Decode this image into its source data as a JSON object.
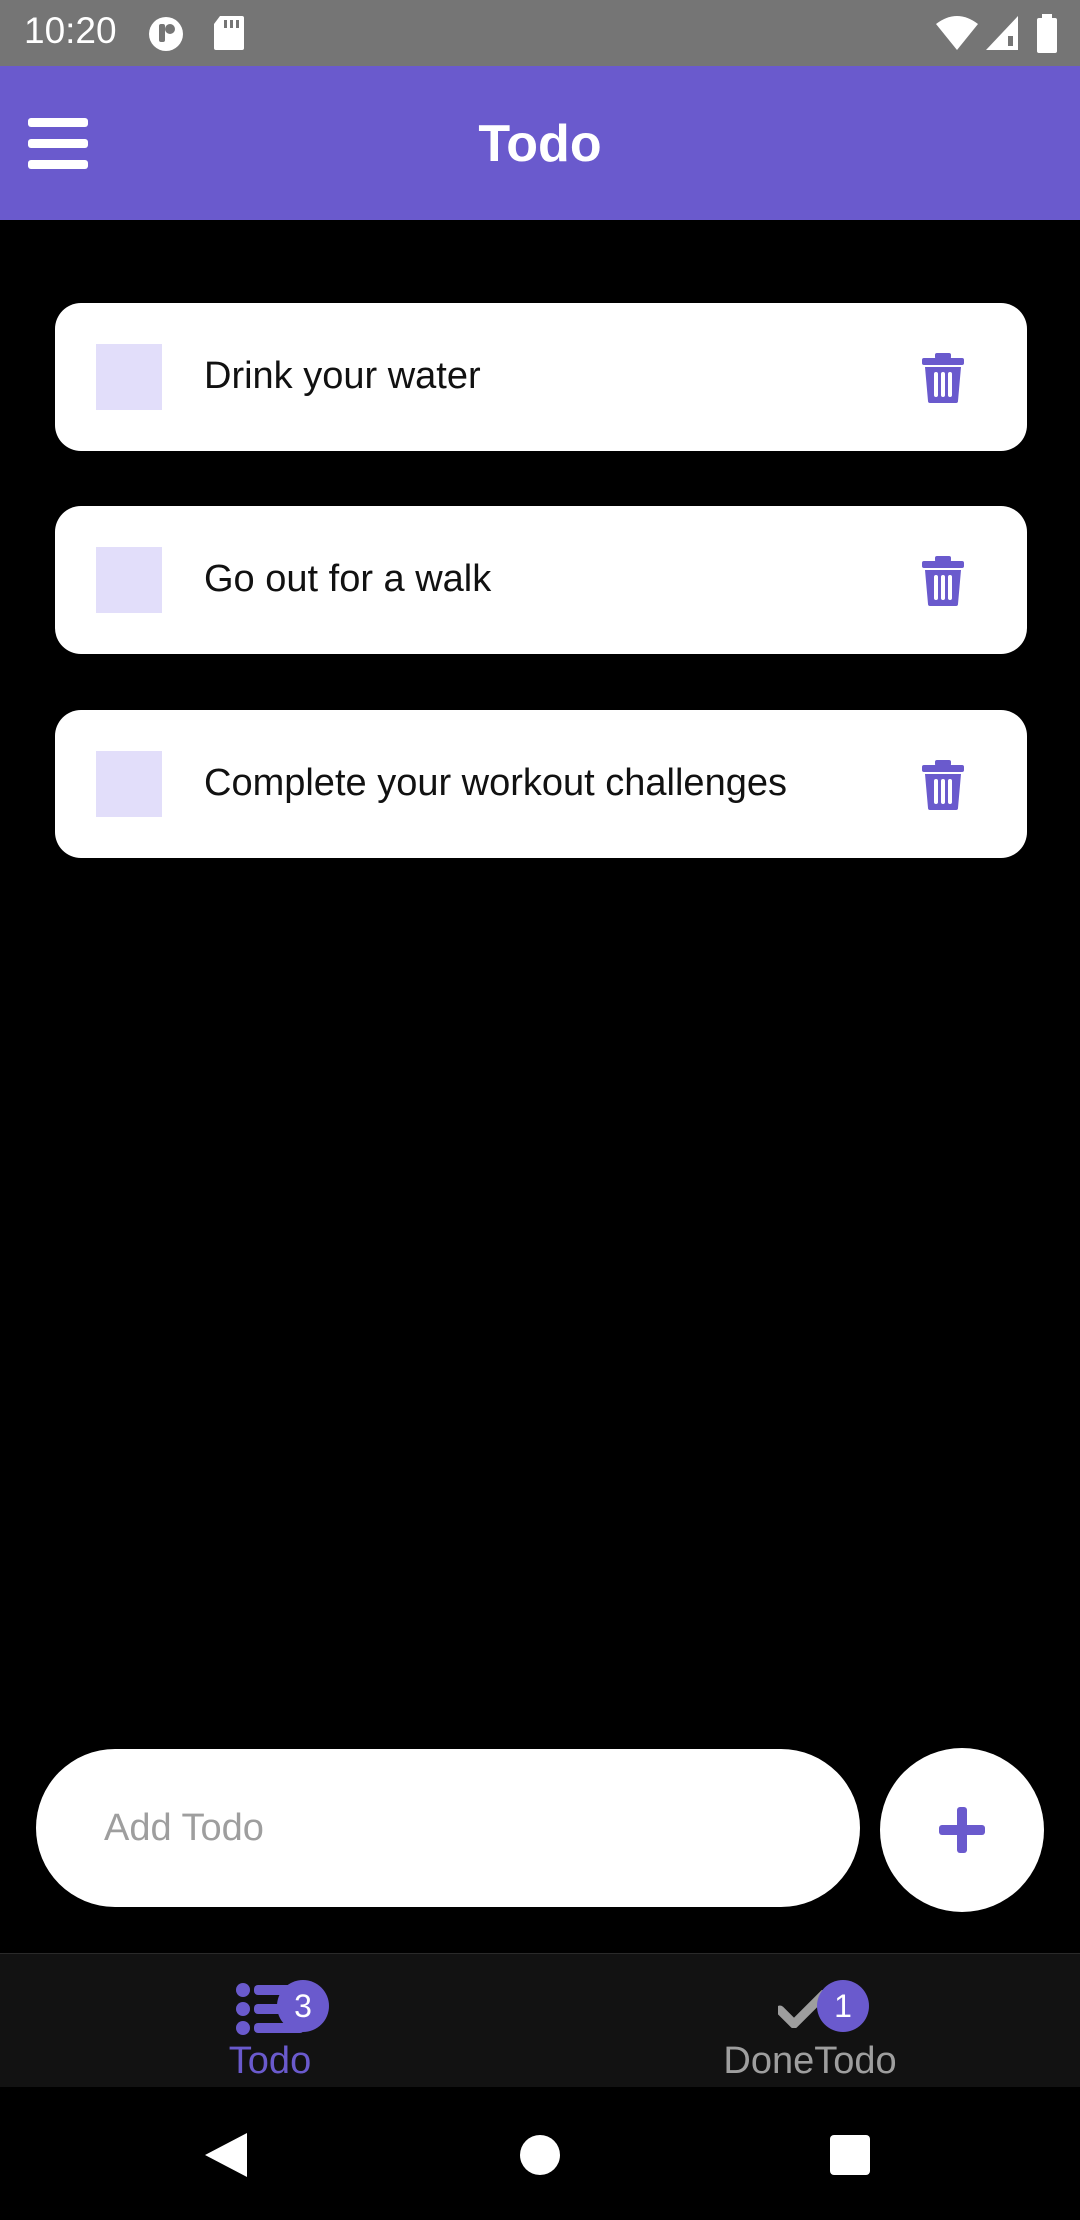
{
  "status_bar": {
    "time": "10:20",
    "icons": [
      "data-saver-icon",
      "sd-card-icon",
      "wifi-icon",
      "signal-icon",
      "battery-icon"
    ]
  },
  "app_bar": {
    "title": "Todo",
    "menu_icon": "hamburger-menu-icon",
    "background": "#6a5acd"
  },
  "todos": [
    {
      "text": "Drink your water",
      "checked": false
    },
    {
      "text": "Go out for a walk",
      "checked": false
    },
    {
      "text": "Complete your workout challenges",
      "checked": false
    }
  ],
  "add_todo": {
    "placeholder": "Add Todo",
    "value": "",
    "button_icon": "plus-icon"
  },
  "bottom_nav": {
    "tabs": [
      {
        "label": "Todo",
        "icon": "list-icon",
        "badge": "3",
        "active": true
      },
      {
        "label": "DoneTodo",
        "icon": "checkmark-icon",
        "badge": "1",
        "active": false
      }
    ]
  },
  "system_nav": {
    "icons": [
      "back-icon",
      "home-icon",
      "recents-icon"
    ]
  },
  "colors": {
    "accent": "#6a5acd",
    "checkbox_fill": "#e2defa",
    "card": "#ffffff",
    "background": "#000000",
    "inactive": "#9e9e9e"
  }
}
